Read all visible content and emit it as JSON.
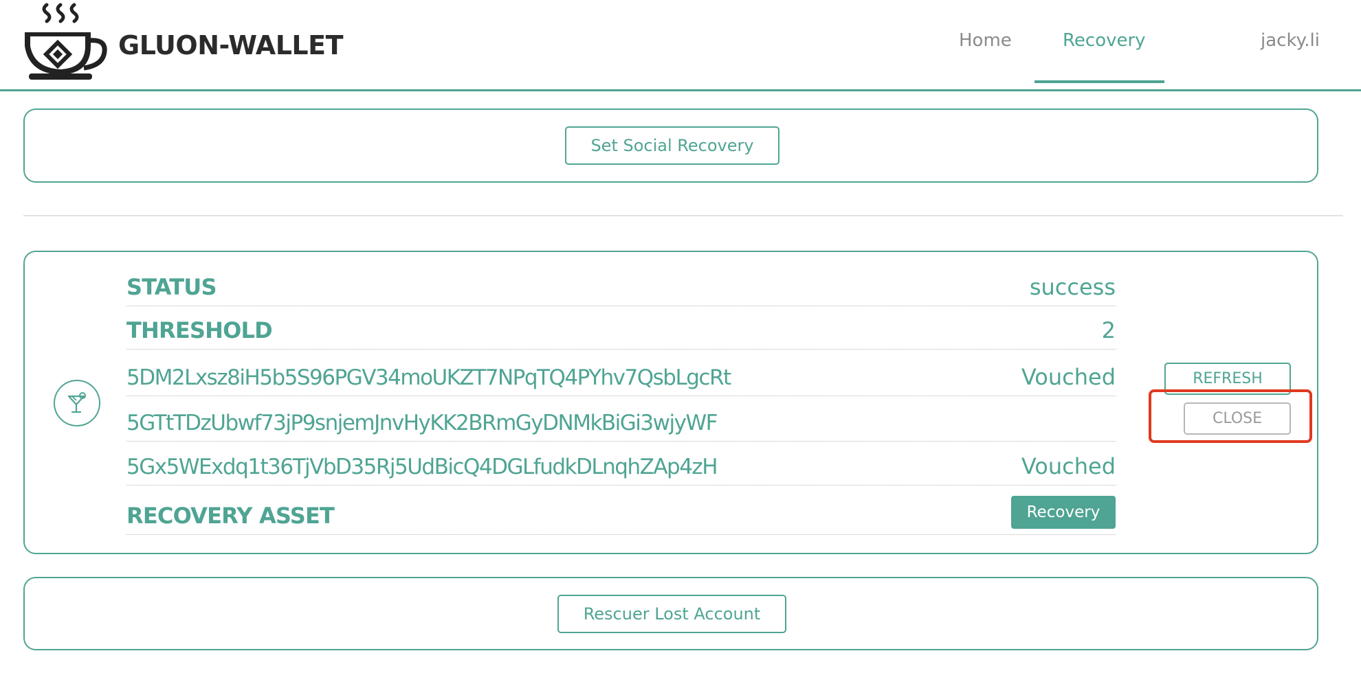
{
  "header": {
    "brand": "GLUON-WALLET",
    "nav": {
      "home": "Home",
      "recovery": "Recovery",
      "user": "jacky.li"
    }
  },
  "top_panel": {
    "button_label": "Set Social Recovery"
  },
  "recovery_info": {
    "status_label": "STATUS",
    "status_value": "success",
    "threshold_label": "THRESHOLD",
    "threshold_value": "2",
    "friends": [
      {
        "address": "5DM2Lxsz8iH5b5S96PGV34moUKZT7NPqTQ4PYhv7QsbLgcRt",
        "status": "Vouched"
      },
      {
        "address": "5GTtTDzUbwf73jP9snjemJnvHyKK2BRmGyDNMkBiGi3wjyWF",
        "status": ""
      },
      {
        "address": "5Gx5WExdq1t36TjVbD35Rj5UdBicQ4DGLfudkDLnqhZAp4zH",
        "status": "Vouched"
      }
    ],
    "asset_label": "RECOVERY ASSET",
    "asset_button": "Recovery",
    "refresh_button": "REFRESH",
    "close_button": "CLOSE",
    "icon": "cocktail-icon"
  },
  "bottom_panel": {
    "button_label": "Rescuer Lost Account"
  },
  "colors": {
    "accent": "#4fa493",
    "highlight": "#e0391f",
    "brand_text": "#2b2b2b",
    "nav_inactive": "#8a8a8a"
  }
}
